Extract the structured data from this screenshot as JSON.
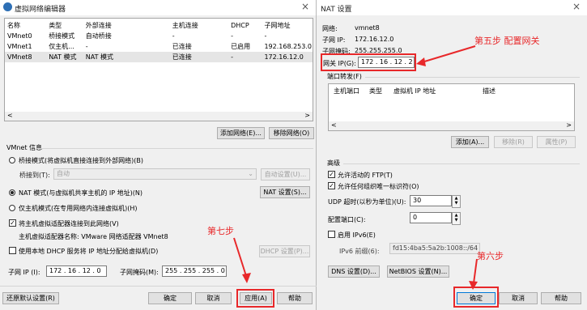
{
  "win1": {
    "title": "虚拟网络编辑器",
    "close": "×",
    "table": {
      "headers": [
        "名称",
        "类型",
        "外部连接",
        "主机连接",
        "DHCP",
        "子网地址"
      ],
      "rows": [
        [
          "VMnet0",
          "桥接模式",
          "自动桥接",
          "-",
          "-",
          "-"
        ],
        [
          "VMnet1",
          "仅主机...",
          "-",
          "已连接",
          "已启用",
          "192.168.253.0"
        ],
        [
          "VMnet8",
          "NAT 模式",
          "NAT 模式",
          "已连接",
          "-",
          "172.16.12.0"
        ]
      ],
      "scroll_left": "<",
      "scroll_right": ">"
    },
    "add_network": "添加网络(E)...",
    "remove_network": "移除网络(O)",
    "info_label": "VMnet 信息",
    "bridge_mode": "桥接模式(将虚拟机直接连接到外部网络)(B)",
    "bridge_to_label": "桥接到(T):",
    "bridge_to_value": "自动",
    "auto_settings": "自动设置(U)...",
    "nat_mode": "NAT 模式(与虚拟机共享主机的 IP 地址)(N)",
    "nat_settings": "NAT 设置(S)...",
    "host_only": "仅主机模式(在专用网络内连接虚拟机)(H)",
    "connect_adapter": "将主机虚拟适配器连接到此网络(V)",
    "adapter_name": "主机虚拟适配器名称: VMware 网络适配器 VMnet8",
    "use_dhcp": "使用本地 DHCP 服务将 IP 地址分配给虚拟机(D)",
    "dhcp_settings": "DHCP 设置(P)...",
    "subnet_ip_label": "子网 IP (I):",
    "subnet_ip": "172 . 16 . 12 . 0",
    "subnet_mask_label": "子网掩码(M):",
    "subnet_mask": "255 . 255 . 255 . 0",
    "restore_defaults": "还原默认设置(R)",
    "ok": "确定",
    "cancel": "取消",
    "apply": "应用(A)",
    "help": "帮助",
    "step7": "第七步"
  },
  "win2": {
    "title": "NAT 设置",
    "close": "×",
    "network_label": "网络:",
    "network_value": "vmnet8",
    "subnet_ip_label": "子网 IP:",
    "subnet_ip": "172.16.12.0",
    "subnet_mask_label": "子网掩码:",
    "subnet_mask": "255.255.255.0",
    "gateway_label": "网关 IP(G):",
    "gateway_value": "172 . 16 . 12 . 2",
    "step5": "第五步 配置网关",
    "port_forward_label": "端口转发(F)",
    "pf_headers": [
      "主机端口",
      "类型",
      "虚拟机 IP 地址",
      "描述"
    ],
    "add": "添加(A)...",
    "remove": "移除(R)",
    "properties": "属性(P)",
    "advanced_label": "高级",
    "allow_ftp": "允许活动的 FTP(T)",
    "allow_oui": "允许任何组织唯一标识符(O)",
    "udp_timeout_label": "UDP 超时(以秒为单位)(U):",
    "udp_timeout": "30",
    "config_port_label": "配置端口(C):",
    "config_port": "0",
    "enable_ipv6": "启用 IPv6(E)",
    "ipv6_prefix_label": "IPv6 前缀(6):",
    "ipv6_prefix": "fd15:4ba5:5a2b:1008::/64",
    "dns_settings": "DNS 设置(D)...",
    "netbios_settings": "NetBIOS 设置(N)...",
    "step6": "第六步",
    "ok": "确定",
    "cancel": "取消",
    "help": "帮助"
  },
  "colors": {
    "annotation_red": "#e8282a",
    "selected_row": "#e5e5e5",
    "accent": "#0078d7"
  },
  "icons": {
    "app_icon": "network-globe-icon",
    "close": "close-icon",
    "spin": "spin-arrows-icon"
  }
}
